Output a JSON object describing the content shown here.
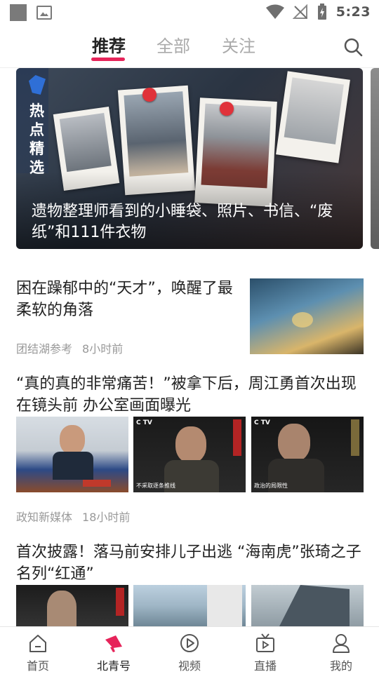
{
  "status_bar": {
    "time": "5:23"
  },
  "tabs": [
    {
      "label": "推荐",
      "active": true
    },
    {
      "label": "全部",
      "active": false
    },
    {
      "label": "关注",
      "active": false
    }
  ],
  "banner": {
    "tag": "热点精选",
    "title": "遗物整理师看到的小睡袋、照片、书信、“废纸”和111件衣物"
  },
  "articles": [
    {
      "title": "困在躁郁中的“天才”，唤醒了最柔软的角落",
      "source": "团结湖参考",
      "time": "8小时前"
    },
    {
      "title": "“真的真的非常痛苦！”被拿下后，周江勇首次出现在镜头前  办公室画面曝光",
      "source": "政知新媒体",
      "time": "18小时前",
      "captions": [
        "不采取逐条推线",
        "政治的局限性"
      ]
    },
    {
      "title": "首次披露！落马前安排儿子出逃 “海南虎”张琦之子名列“红通”"
    }
  ],
  "bottom_nav": [
    {
      "label": "首页",
      "icon": "home-icon"
    },
    {
      "label": "北青号",
      "icon": "megaphone-icon",
      "active": true
    },
    {
      "label": "视频",
      "icon": "play-icon"
    },
    {
      "label": "直播",
      "icon": "live-tv-icon"
    },
    {
      "label": "我的",
      "icon": "user-icon"
    }
  ],
  "colors": {
    "accent": "#e6245a",
    "pin": "#e0323a"
  }
}
